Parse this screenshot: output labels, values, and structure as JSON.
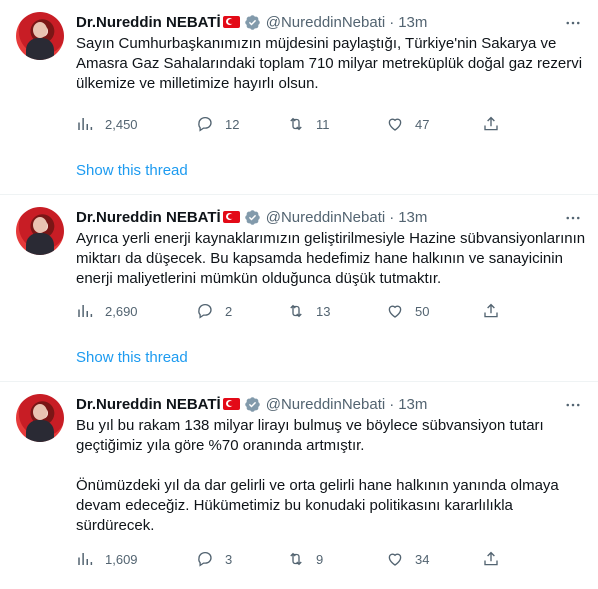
{
  "colors": {
    "accent": "#1d9bf0",
    "muted": "#536471",
    "text": "#0f1419",
    "flag": "#e30a17"
  },
  "tweets": [
    {
      "name": "Dr.Nureddin NEBATİ",
      "handle": "@NureddinNebati",
      "dot": "·",
      "time": "13m",
      "text": "Sayın Cumhurbaşkanımızın müjdesini paylaştığı, Türkiye'nin Sakarya ve\nAmasra Gaz Sahalarındaki toplam 710 milyar metreküplük doğal gaz rezervi\nülkemize ve milletimize hayırlı olsun.",
      "views": "2,450",
      "replies": "12",
      "retweets": "11",
      "likes": "47",
      "show_thread": "Show this thread"
    },
    {
      "name": "Dr.Nureddin NEBATİ",
      "handle": "@NureddinNebati",
      "dot": "·",
      "time": "13m",
      "text": "Ayrıca yerli enerji kaynaklarımızın geliştirilmesiyle Hazine sübvansiyonlarının\nmiktarı da düşecek. Bu kapsamda hedefimiz hane halkının ve sanayicinin\nenerji maliyetlerini mümkün olduğunca düşük tutmaktır.",
      "views": "2,690",
      "replies": "2",
      "retweets": "13",
      "likes": "50",
      "show_thread": "Show this thread"
    },
    {
      "name": "Dr.Nureddin NEBATİ",
      "handle": "@NureddinNebati",
      "dot": "·",
      "time": "13m",
      "text": "Bu yıl bu rakam 138 milyar lirayı bulmuş ve böylece sübvansiyon tutarı\ngeçtiğimiz yıla göre %70 oranında artmıştır.\n\nÖnümüzdeki yıl da dar gelirli ve orta gelirli hane halkının yanında olmaya\ndevam edeceğiz. Hükümetimiz bu konudaki politikasını kararlılıkla\nsürdürecek.",
      "views": "1,609",
      "replies": "3",
      "retweets": "9",
      "likes": "34"
    }
  ]
}
